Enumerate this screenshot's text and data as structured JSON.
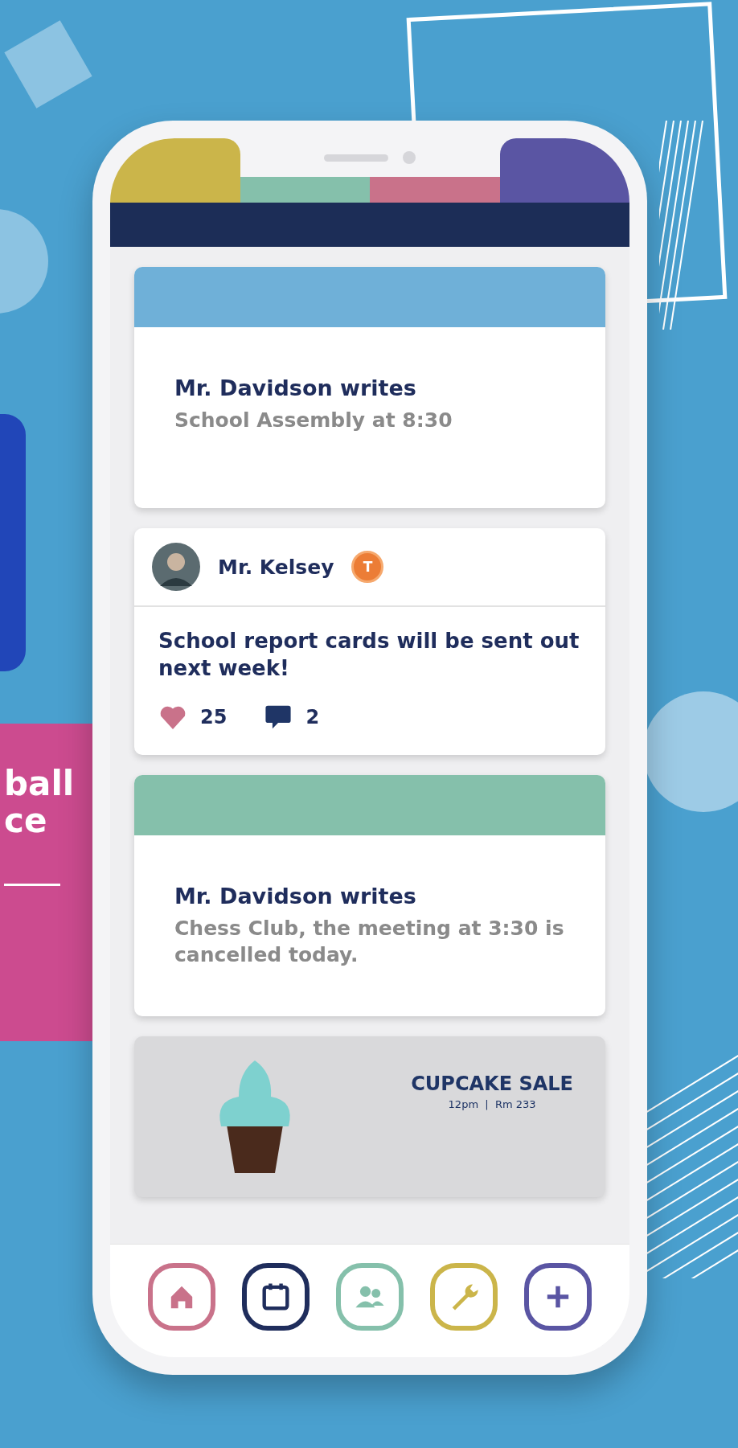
{
  "promo_card": {
    "lines": [
      "ball",
      "ce"
    ]
  },
  "phone": {
    "header_tabs": [
      {
        "color": "#cbb54a"
      },
      {
        "color": "#85c0ab"
      },
      {
        "color": "#c9728a"
      },
      {
        "color": "#5a55a3"
      }
    ],
    "feed": [
      {
        "kind": "announcement",
        "color": "#6fb0d8",
        "author": "Mr. Davidson writes",
        "text": "School Assembly at 8:30"
      },
      {
        "kind": "post",
        "author": "Mr. Kelsey",
        "badge": "T",
        "text": "School report cards will be sent out next week!",
        "likes": "25",
        "comments": "2"
      },
      {
        "kind": "announcement",
        "color": "#85c0ab",
        "author": "Mr. Davidson writes",
        "text": "Chess Club, the meeting at 3:30 is cancelled today."
      },
      {
        "kind": "banner",
        "title": "CUPCAKE SALE",
        "subtitle": "12pm  |  Rm 233"
      }
    ],
    "nav": [
      {
        "kind": "home",
        "color": "#c9728a"
      },
      {
        "kind": "calendar",
        "color": "#1f2d5c"
      },
      {
        "kind": "people",
        "color": "#85c0ab"
      },
      {
        "kind": "wrench",
        "color": "#cbb54a"
      },
      {
        "kind": "plus",
        "color": "#5a55a3"
      }
    ]
  }
}
